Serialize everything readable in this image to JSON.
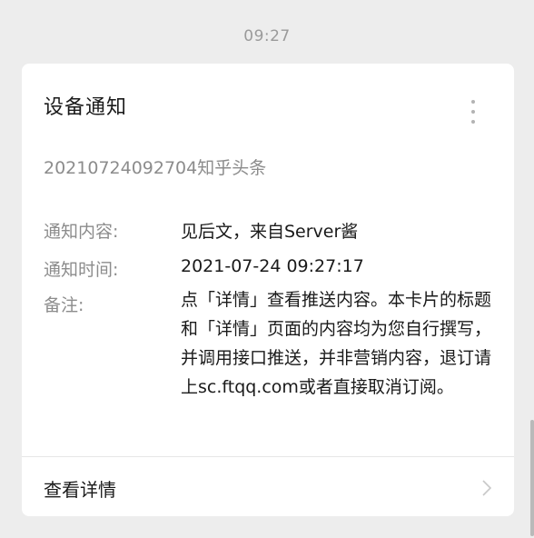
{
  "timestamp": "09:27",
  "card": {
    "title": "设备通知",
    "subtitle": "20210724092704知乎头条",
    "fields": [
      {
        "label": "通知内容:",
        "value": "见后文，来自Server酱"
      },
      {
        "label": "通知时间:",
        "value": "2021-07-24 09:27:17"
      },
      {
        "label": "备注:",
        "value": "点「详情」查看推送内容。本卡片的标题和「详情」页面的内容均为您自行撰写，并调用接口推送，并非营销内容，退订请上sc.ftqq.com或者直接取消订阅。"
      }
    ],
    "detail_label": "查看详情"
  },
  "icons": {
    "more": "more-vertical-icon",
    "chevron": "chevron-right-icon"
  },
  "colors": {
    "background": "#ededed",
    "card": "#ffffff",
    "secondary_text": "#8c8c8c",
    "primary_text": "#1a1a1a"
  }
}
